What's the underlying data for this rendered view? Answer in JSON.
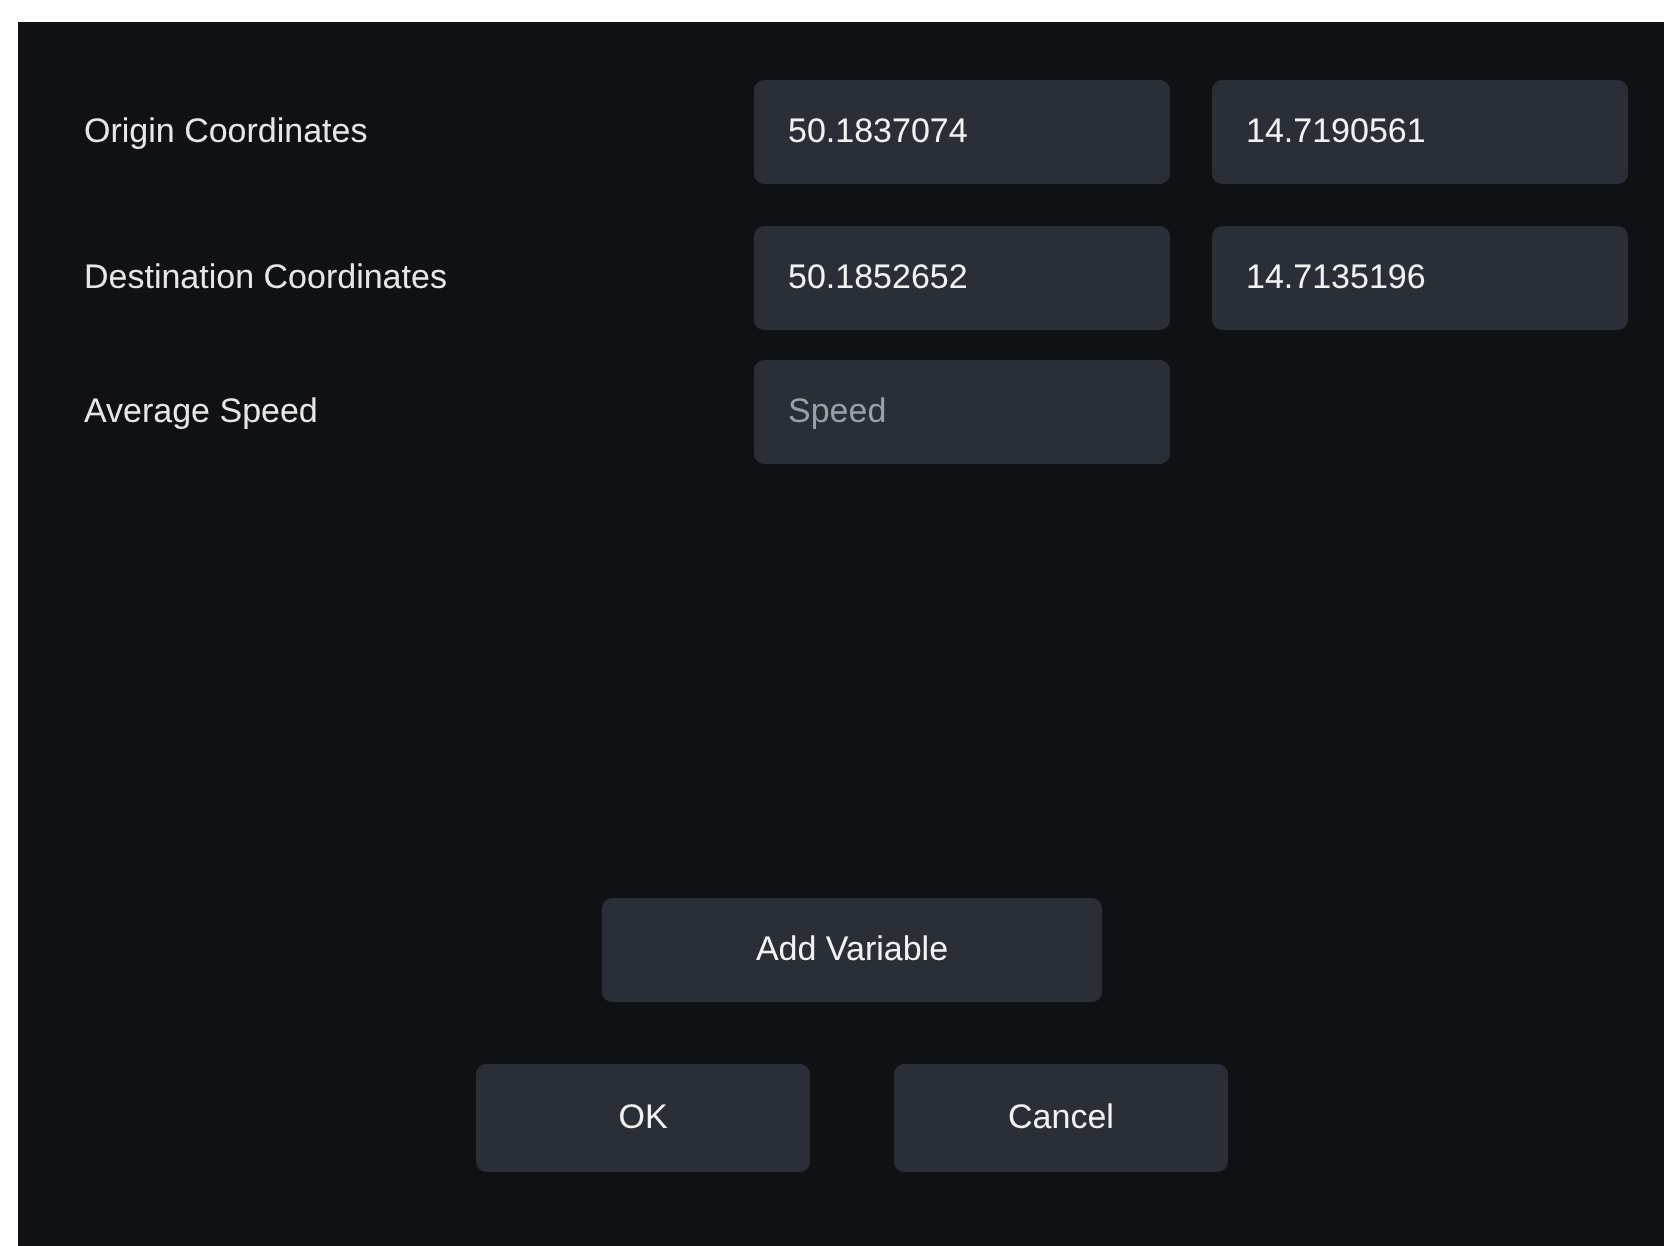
{
  "rows": [
    {
      "label": "Origin Coordinates",
      "fields": [
        {
          "value": "50.1837074"
        },
        {
          "value": "14.7190561"
        }
      ]
    },
    {
      "label": "Destination Coordinates",
      "fields": [
        {
          "value": "50.1852652"
        },
        {
          "value": "14.7135196"
        }
      ]
    },
    {
      "label": "Average Speed",
      "fields": [
        {
          "placeholder": "Speed"
        }
      ]
    }
  ],
  "add_button": "Add Variable",
  "buttons": [
    "OK",
    "Cancel"
  ]
}
